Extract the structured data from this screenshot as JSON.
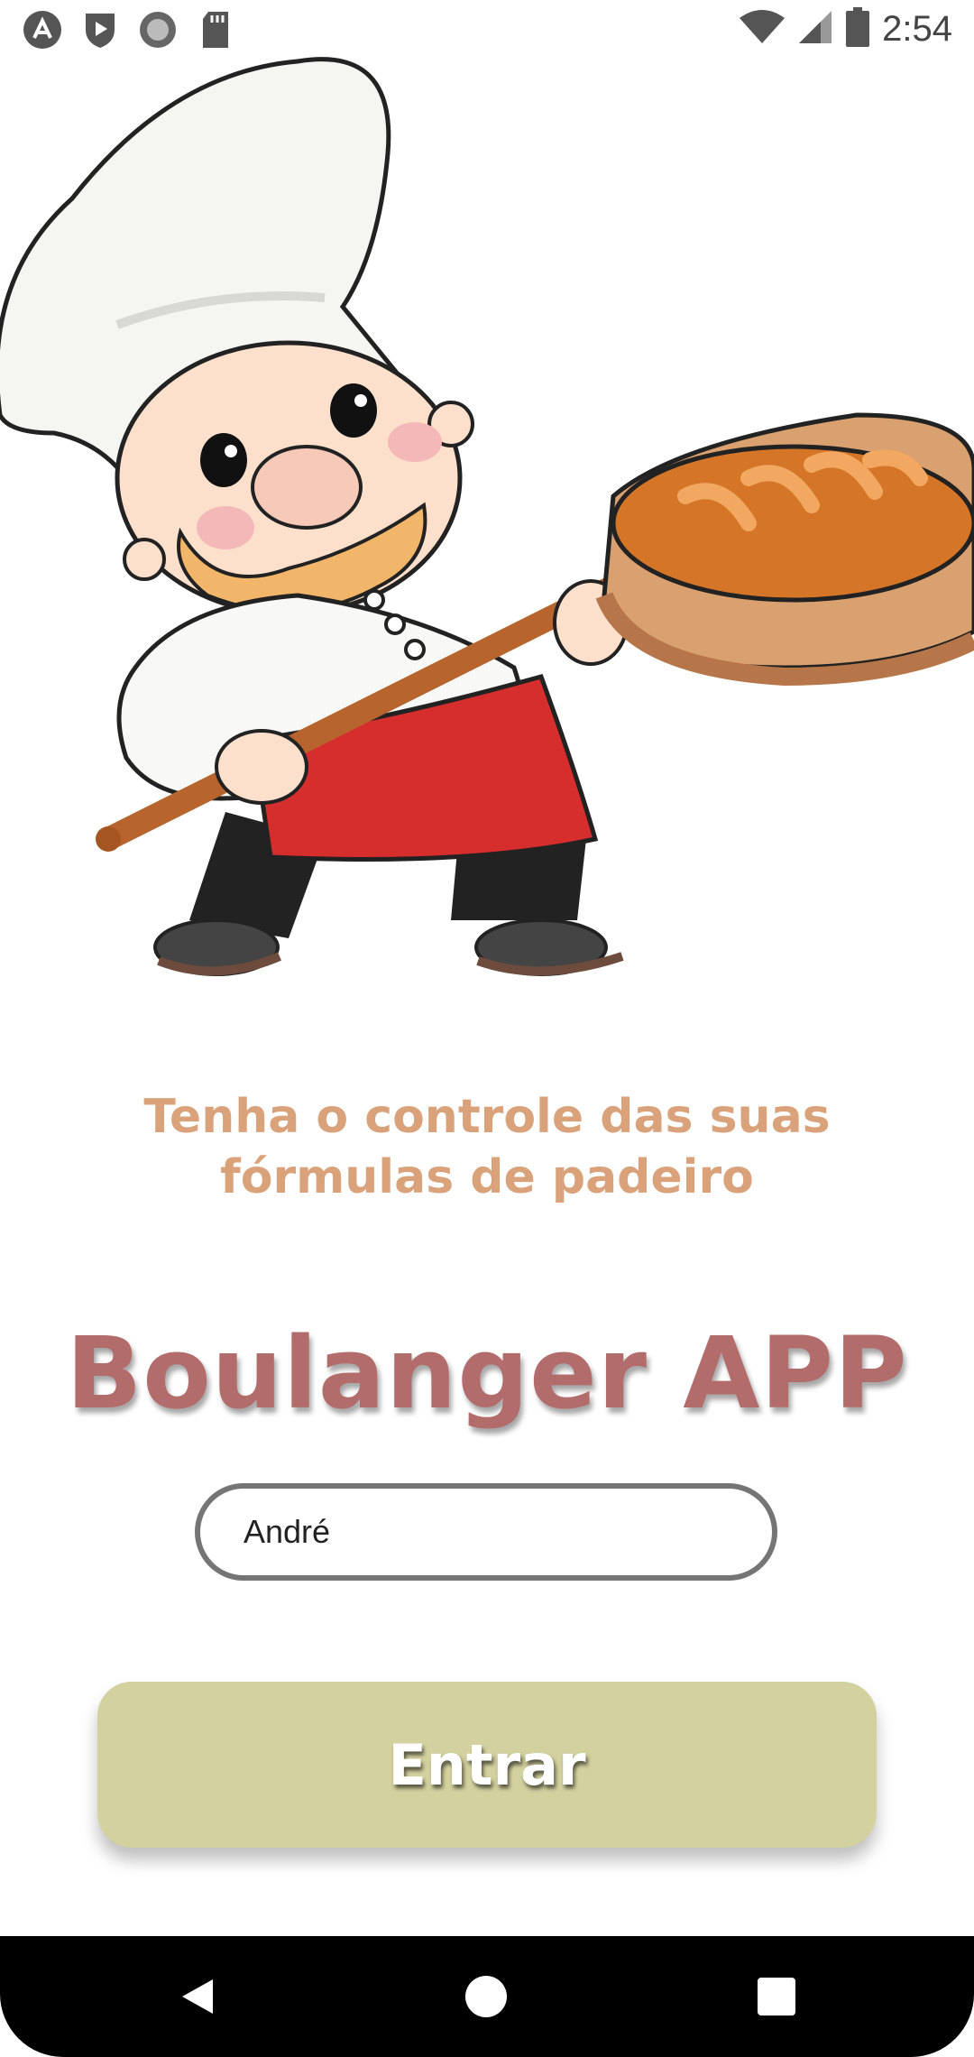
{
  "status_bar": {
    "time": "2:54",
    "icons_left": [
      "app-a-icon",
      "shield-play-icon",
      "circle-record-icon",
      "sd-card-icon"
    ],
    "icons_right": [
      "wifi-icon",
      "signal-icon",
      "battery-icon"
    ]
  },
  "hero": {
    "image": "baker-chef-illustration"
  },
  "subtitle": {
    "line1": "Tenha o controle das suas",
    "line2": "fórmulas de padeiro"
  },
  "app_title": "Boulanger APP",
  "name_input": {
    "value": "André"
  },
  "enter_button": {
    "label": "Entrar"
  },
  "nav_bar": {
    "buttons": [
      "back",
      "home",
      "recents"
    ]
  },
  "colors": {
    "subtitle": "#d9a27a",
    "title": "#b36c6c",
    "button": "#d3d19f",
    "input_border": "#757575"
  }
}
